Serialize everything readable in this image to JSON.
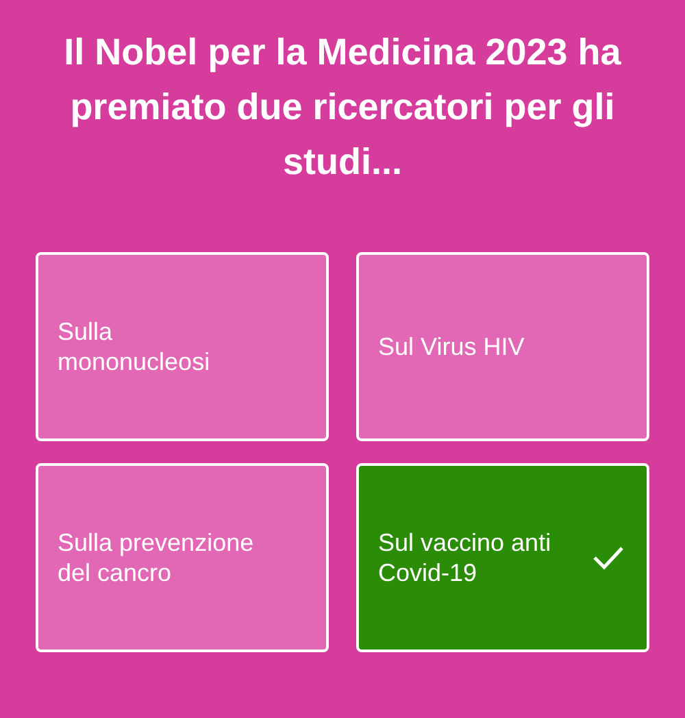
{
  "question": "Il Nobel per la Medicina 2023 ha premiato due ricercatori per gli studi...",
  "answers": [
    {
      "label": "Sulla mononucleosi",
      "correct": false
    },
    {
      "label": "Sul Virus HIV",
      "correct": false
    },
    {
      "label": "Sulla prevenzione del cancro",
      "correct": false
    },
    {
      "label": "Sul vaccino anti Covid-19",
      "correct": true
    }
  ]
}
